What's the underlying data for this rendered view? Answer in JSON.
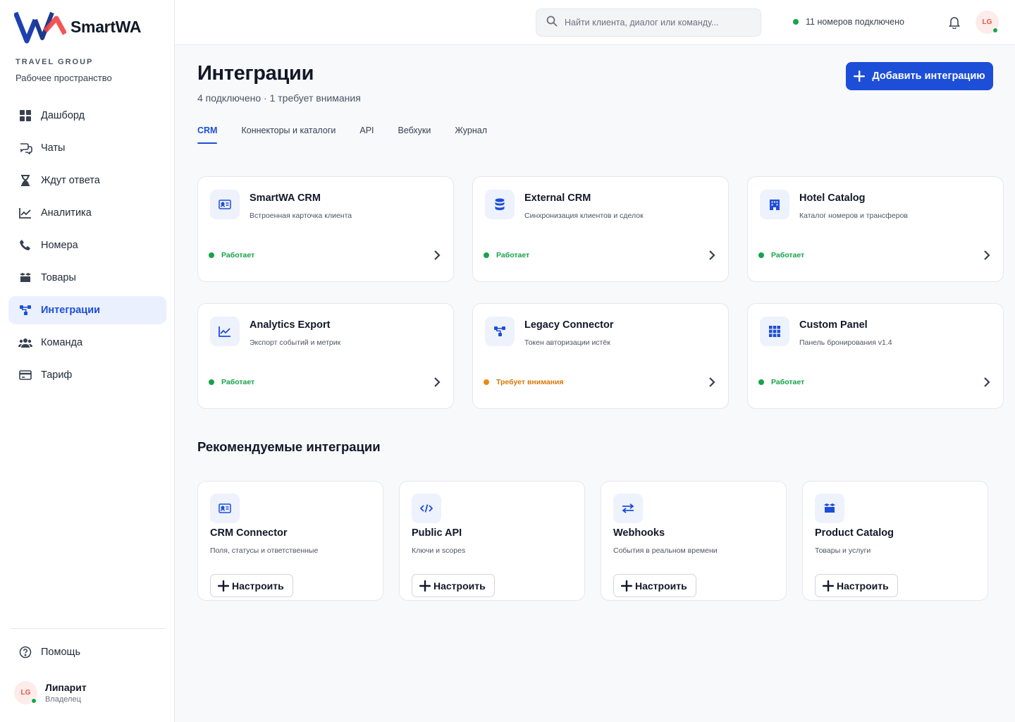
{
  "brand": {
    "name": "SmartWA",
    "group": "TRAVEL GROUP",
    "workspace": "Рабочее пространство"
  },
  "sidebar": {
    "items": [
      {
        "label": "Дашборд",
        "icon": "dashboard-icon"
      },
      {
        "label": "Чаты",
        "icon": "chats-icon"
      },
      {
        "label": "Ждут ответа",
        "icon": "hourglass-icon"
      },
      {
        "label": "Аналитика",
        "icon": "analytics-icon"
      },
      {
        "label": "Номера",
        "icon": "phone-icon"
      },
      {
        "label": "Товары",
        "icon": "products-icon"
      },
      {
        "label": "Интеграции",
        "icon": "integrations-icon",
        "active": true
      },
      {
        "label": "Команда",
        "icon": "team-icon"
      },
      {
        "label": "Тариф",
        "icon": "card-icon"
      }
    ],
    "help": "Помощь"
  },
  "user": {
    "initials": "LG",
    "name": "Липарит",
    "role": "Владелец"
  },
  "topbar": {
    "search_placeholder": "Найти клиента, диалог или команду...",
    "numbers_status": "11 номеров подключено",
    "avatar_initials": "LG"
  },
  "page": {
    "title": "Интеграции",
    "subtitle": "4 подключено · 1 требует внимания",
    "add_button": "Добавить интеграцию"
  },
  "tabs": [
    {
      "label": "CRM",
      "active": true
    },
    {
      "label": "Коннекторы и каталоги"
    },
    {
      "label": "API"
    },
    {
      "label": "Вебхуки"
    },
    {
      "label": "Журнал"
    }
  ],
  "integrations": [
    {
      "title": "SmartWA CRM",
      "desc": "Встроенная карточка клиента",
      "status": "Работает",
      "state": "ok",
      "icon": "id-card-icon"
    },
    {
      "title": "External CRM",
      "desc": "Синхронизация клиентов и сделок",
      "status": "Работает",
      "state": "ok",
      "icon": "database-icon"
    },
    {
      "title": "Hotel Catalog",
      "desc": "Каталог номеров и трансферов",
      "status": "Работает",
      "state": "ok",
      "icon": "hotel-icon"
    },
    {
      "title": "Analytics Export",
      "desc": "Экспорт событий и метрик",
      "status": "Работает",
      "state": "ok",
      "icon": "chart-line-icon"
    },
    {
      "title": "Legacy Connector",
      "desc": "Токен авторизации истёк",
      "status": "Требует внимания",
      "state": "warn",
      "icon": "network-icon"
    },
    {
      "title": "Custom Panel",
      "desc": "Панель бронирования v1.4",
      "status": "Работает",
      "state": "ok",
      "icon": "grid-icon"
    }
  ],
  "recommended": {
    "title": "Рекомендуемые интеграции",
    "button": "Настроить",
    "items": [
      {
        "title": "CRM Connector",
        "desc": "Поля, статусы и ответственные",
        "icon": "id-card-icon"
      },
      {
        "title": "Public API",
        "desc": "Ключи и scopes",
        "icon": "code-icon"
      },
      {
        "title": "Webhooks",
        "desc": "События в реальном времени",
        "icon": "swap-icon"
      },
      {
        "title": "Product Catalog",
        "desc": "Товары и услуги",
        "icon": "products-icon"
      }
    ]
  },
  "colors": {
    "accent": "#1d4ed8",
    "ok": "#16a34a",
    "warn": "#d97706",
    "avatar_bg": "#fdecea"
  }
}
